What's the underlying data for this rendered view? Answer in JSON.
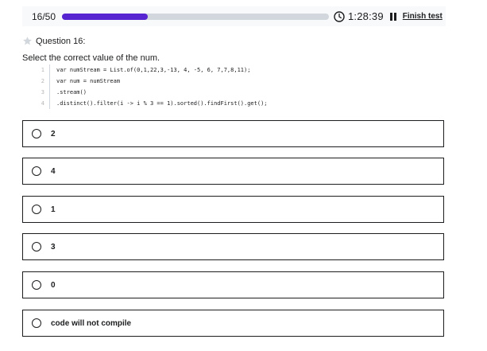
{
  "header": {
    "counter": "16/50",
    "progress_fraction": 0.32,
    "timer": "1:28:39",
    "finish_label": "Finish test",
    "icons": {
      "clock": "clock-icon",
      "pause": "pause-icon"
    },
    "colors": {
      "progress_fill": "#5624d0",
      "progress_track": "#d1d7dc"
    }
  },
  "question": {
    "title": "Question 16:",
    "prompt": "Select the correct value of the num.",
    "code_lines": [
      {
        "num": "1",
        "text": "var numStream = List.of(0,1,22,3,-13, 4, -5, 6, 7,7,8,11);"
      },
      {
        "num": "2",
        "text": "var num = numStream"
      },
      {
        "num": "3",
        "text": ".stream()"
      },
      {
        "num": "4",
        "text": ".distinct().filter(i -> i % 3 == 1).sorted().findFirst().get();"
      }
    ]
  },
  "options": [
    {
      "label": "2"
    },
    {
      "label": "4"
    },
    {
      "label": "1"
    },
    {
      "label": "3"
    },
    {
      "label": "0"
    },
    {
      "label": "code will not compile"
    }
  ]
}
